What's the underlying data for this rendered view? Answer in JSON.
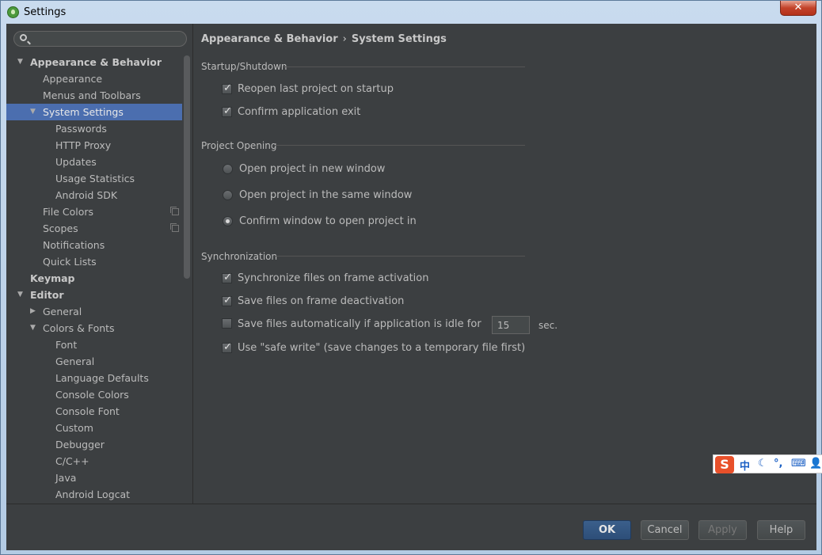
{
  "window": {
    "title": "Settings",
    "close_glyph": "✕"
  },
  "search": {
    "placeholder": "",
    "icon": "search-icon"
  },
  "tree": [
    {
      "label": "Appearance & Behavior",
      "level": 0,
      "arrow": "▼",
      "bold": true
    },
    {
      "label": "Appearance",
      "level": 1
    },
    {
      "label": "Menus and Toolbars",
      "level": 1
    },
    {
      "label": "System Settings",
      "level": 1,
      "arrow": "▼",
      "selected": true
    },
    {
      "label": "Passwords",
      "level": 2
    },
    {
      "label": "HTTP Proxy",
      "level": 2
    },
    {
      "label": "Updates",
      "level": 2
    },
    {
      "label": "Usage Statistics",
      "level": 2
    },
    {
      "label": "Android SDK",
      "level": 2
    },
    {
      "label": "File Colors",
      "level": 1,
      "copy": true
    },
    {
      "label": "Scopes",
      "level": 1,
      "copy": true
    },
    {
      "label": "Notifications",
      "level": 1
    },
    {
      "label": "Quick Lists",
      "level": 1
    },
    {
      "label": "Keymap",
      "level": 0,
      "bold": true
    },
    {
      "label": "Editor",
      "level": 0,
      "arrow": "▼",
      "bold": true
    },
    {
      "label": "General",
      "level": 1,
      "arrow": "▶"
    },
    {
      "label": "Colors & Fonts",
      "level": 1,
      "arrow": "▼"
    },
    {
      "label": "Font",
      "level": 2
    },
    {
      "label": "General",
      "level": 2
    },
    {
      "label": "Language Defaults",
      "level": 2
    },
    {
      "label": "Console Colors",
      "level": 2
    },
    {
      "label": "Console Font",
      "level": 2
    },
    {
      "label": "Custom",
      "level": 2
    },
    {
      "label": "Debugger",
      "level": 2
    },
    {
      "label": "C/C++",
      "level": 2
    },
    {
      "label": "Java",
      "level": 2
    },
    {
      "label": "Android Logcat",
      "level": 2
    }
  ],
  "breadcrumb": {
    "parent": "Appearance & Behavior",
    "separator": "›",
    "current": "System Settings"
  },
  "startup": {
    "title": "Startup/Shutdown",
    "reopen_label": "Reopen last project on startup",
    "reopen_checked": true,
    "confirm_exit_label": "Confirm application exit",
    "confirm_exit_checked": true
  },
  "project_opening": {
    "title": "Project Opening",
    "options": [
      "Open project in new window",
      "Open project in the same window",
      "Confirm window to open project in"
    ],
    "selected_index": 2
  },
  "sync": {
    "title": "Synchronization",
    "frame_activation_label": "Synchronize files on frame activation",
    "frame_activation_checked": true,
    "frame_deactivation_label": "Save files on frame deactivation",
    "frame_deactivation_checked": true,
    "idle_label": "Save files automatically if application is idle for",
    "idle_checked": false,
    "idle_value": "15",
    "idle_unit": "sec.",
    "safe_write_label": "Use \"safe write\" (save changes to a temporary file first)",
    "safe_write_checked": true
  },
  "buttons": {
    "ok": "OK",
    "cancel": "Cancel",
    "apply": "Apply",
    "help": "Help"
  },
  "ime": {
    "logo": "S",
    "lang": "中",
    "moon": "☾",
    "punct": "°,",
    "keyboard": "⌨",
    "user": "👤"
  },
  "colors": {
    "selection": "#4b6eaf",
    "background": "#3c3f41",
    "ok_button": "#2d4e78"
  }
}
